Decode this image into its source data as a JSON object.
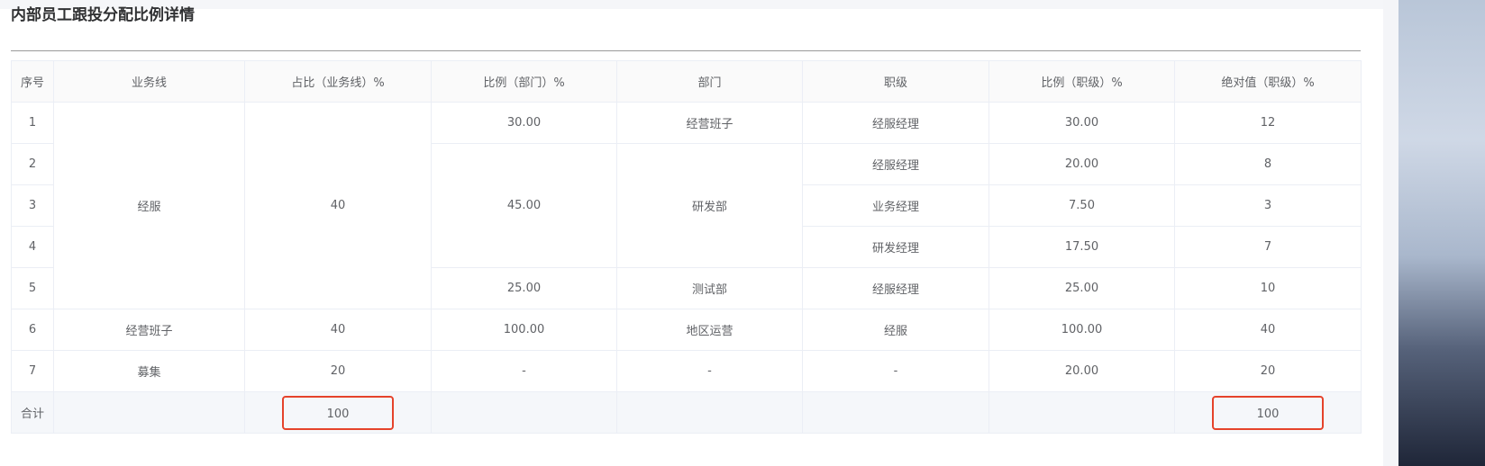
{
  "page": {
    "title": "内部员工跟投分配比例详情"
  },
  "table": {
    "headers": [
      "序号",
      "业务线",
      "占比（业务线）%",
      "比例（部门）%",
      "部门",
      "职级",
      "比例（职级）%",
      "绝对值（职级）%"
    ],
    "rows": [
      {
        "no": "1",
        "line": "经服",
        "line_pct": "40",
        "dept_pct": "30.00",
        "dept": "经营班子",
        "level": "经服经理",
        "level_pct": "30.00",
        "abs": "12"
      },
      {
        "no": "2",
        "dept_pct": "45.00",
        "dept": "研发部",
        "level": "经服经理",
        "level_pct": "20.00",
        "abs": "8"
      },
      {
        "no": "3",
        "level": "业务经理",
        "level_pct": "7.50",
        "abs": "3"
      },
      {
        "no": "4",
        "level": "研发经理",
        "level_pct": "17.50",
        "abs": "7"
      },
      {
        "no": "5",
        "dept_pct": "25.00",
        "dept": "测试部",
        "level": "经服经理",
        "level_pct": "25.00",
        "abs": "10"
      },
      {
        "no": "6",
        "line": "经营班子",
        "line_pct": "40",
        "dept_pct": "100.00",
        "dept": "地区运营",
        "level": "经服",
        "level_pct": "100.00",
        "abs": "40"
      },
      {
        "no": "7",
        "line": "募集",
        "line_pct": "20",
        "dept_pct": "-",
        "dept": "-",
        "level": "-",
        "level_pct": "20.00",
        "abs": "20"
      }
    ],
    "total": {
      "label": "合计",
      "line_pct": "100",
      "abs": "100"
    }
  },
  "colors": {
    "highlight_border": "#e5432b",
    "border": "#ebeef5"
  }
}
